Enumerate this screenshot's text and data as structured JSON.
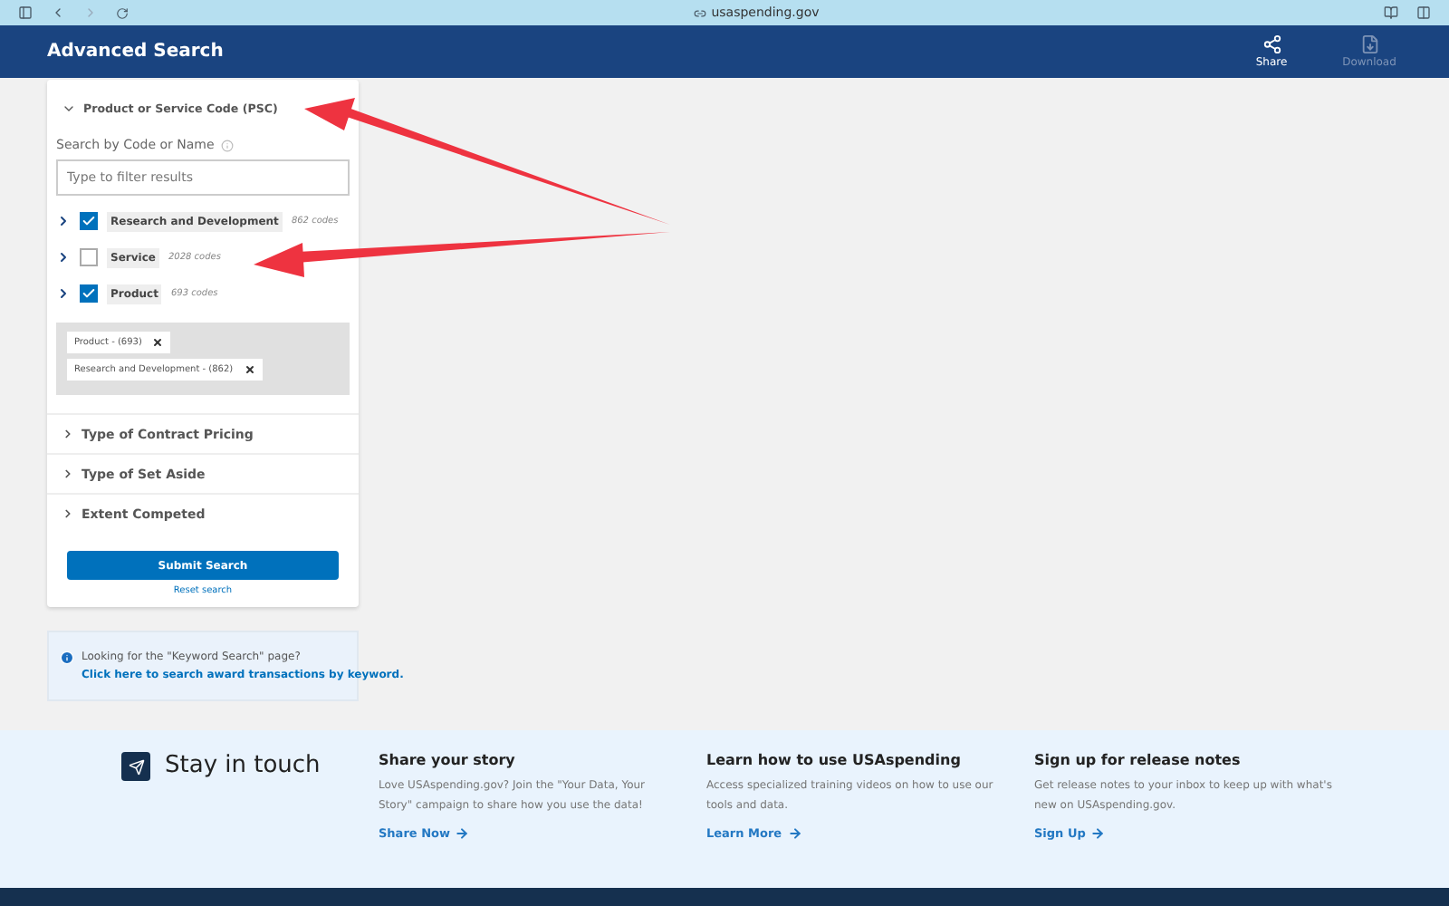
{
  "browser": {
    "url": "usaspending.gov"
  },
  "header": {
    "title": "Advanced Search",
    "actions": [
      {
        "label": "Share",
        "kind": "share",
        "disabled": false
      },
      {
        "label": "Download",
        "kind": "download",
        "disabled": true
      }
    ]
  },
  "filter": {
    "title": "Product or Service Code (PSC)",
    "expanded": true,
    "search_label": "Search by Code or Name",
    "placeholder": "Type to filter results",
    "items": [
      {
        "label": "Research and Development",
        "count": "862 codes",
        "checked": true
      },
      {
        "label": "Service",
        "count": "2028 codes",
        "checked": false
      },
      {
        "label": "Product",
        "count": "693 codes",
        "checked": true
      }
    ],
    "selected_tags": [
      {
        "label": "Product - (693)"
      },
      {
        "label": "Research and Development - (862)"
      }
    ],
    "sections": [
      {
        "title": "Type of Contract Pricing",
        "expanded": false
      },
      {
        "title": "Type of Set Aside",
        "expanded": false
      },
      {
        "title": "Extent Competed",
        "expanded": false
      }
    ],
    "submit": "Submit Search",
    "reset": "Reset search"
  },
  "info": {
    "text": "Looking for the \"Keyword Search\" page?",
    "link": "Click here to search award transactions by keyword."
  },
  "footer": {
    "title": "Stay in touch",
    "columns": [
      {
        "heading": "Share your story",
        "body": "Love USAspending.gov? Join the \"Your Data, Your Story\" campaign to share how you use the data!",
        "link": "Share Now"
      },
      {
        "heading": "Learn how to use USAspending",
        "body": "Access specialized training videos on how to use our tools and data.",
        "link": "Learn More"
      },
      {
        "heading": "Sign up for release notes",
        "body": "Get release notes to your inbox to keep up with what's new on USAspending.gov.",
        "link": "Sign Up"
      }
    ]
  }
}
